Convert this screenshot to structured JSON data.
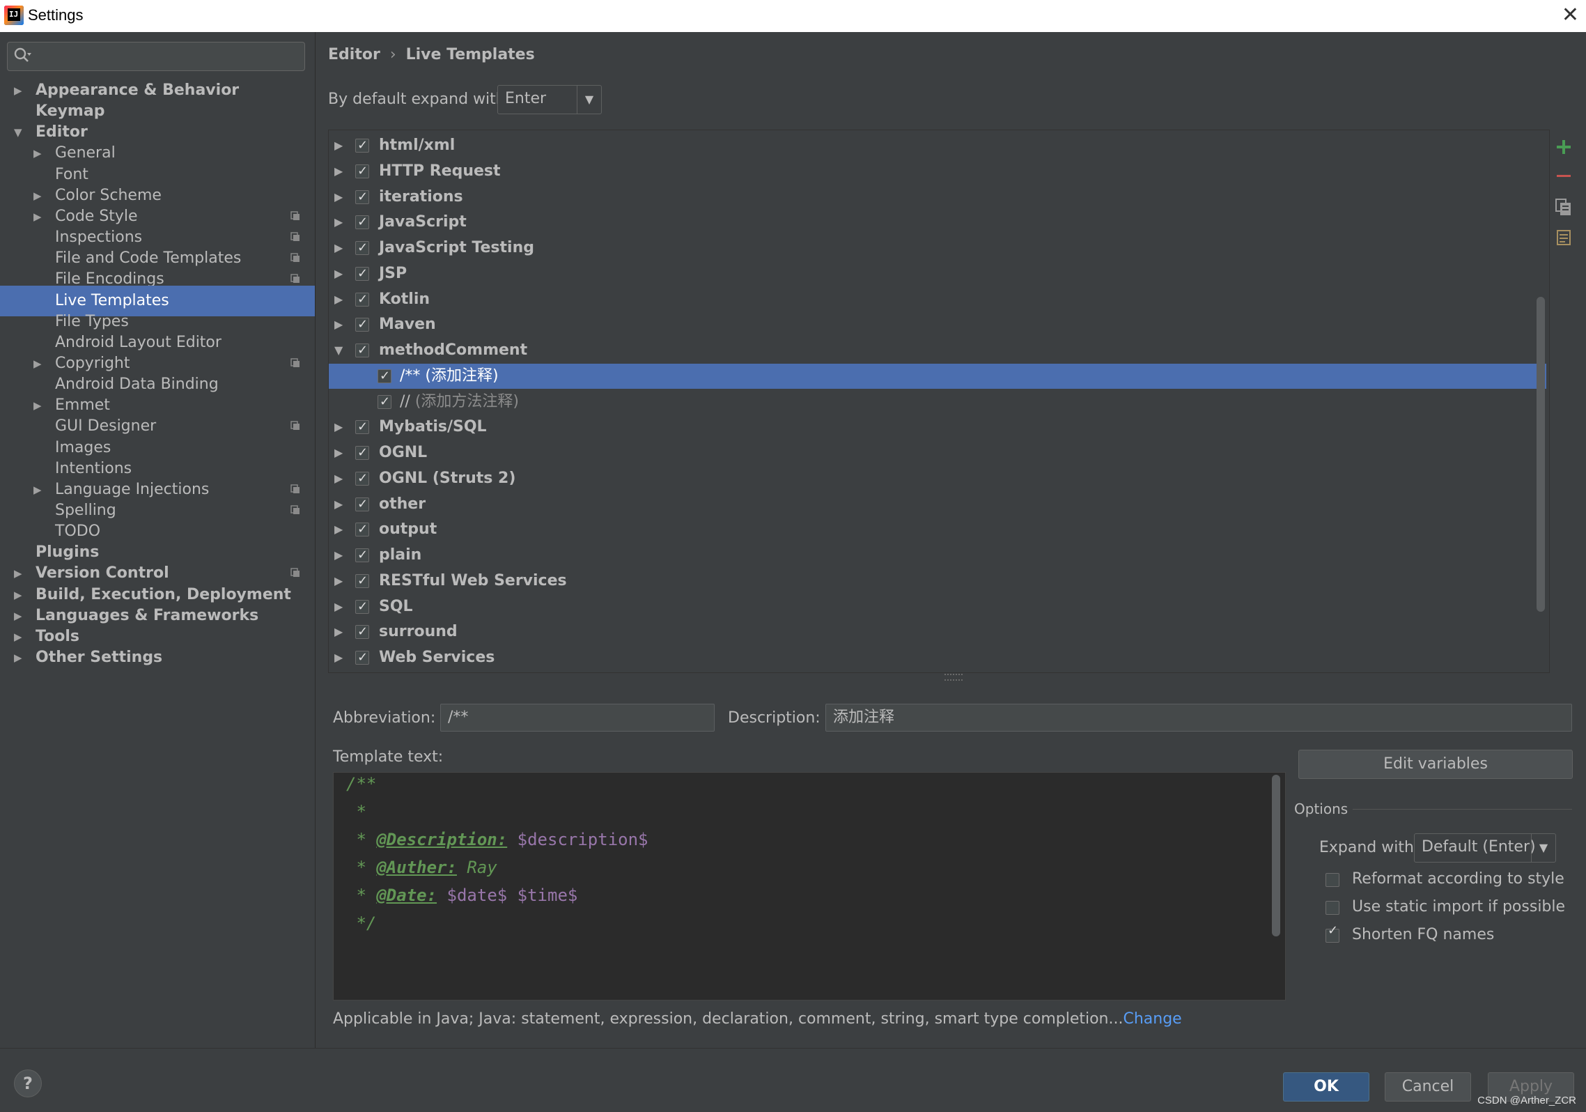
{
  "window": {
    "title": "Settings",
    "close_glyph": "✕",
    "logo_text": "IJ"
  },
  "search": {
    "placeholder": ""
  },
  "sidebar": {
    "items": [
      {
        "label": "Appearance & Behavior",
        "level": 0,
        "arrow": "▶",
        "bold": true
      },
      {
        "label": "Keymap",
        "level": 0,
        "arrow": "",
        "bold": true
      },
      {
        "label": "Editor",
        "level": 0,
        "arrow": "▼",
        "bold": true
      },
      {
        "label": "General",
        "level": 1,
        "arrow": "▶"
      },
      {
        "label": "Font",
        "level": 1,
        "arrow": ""
      },
      {
        "label": "Color Scheme",
        "level": 1,
        "arrow": "▶"
      },
      {
        "label": "Code Style",
        "level": 1,
        "arrow": "▶",
        "project_icon": true
      },
      {
        "label": "Inspections",
        "level": 1,
        "arrow": "",
        "project_icon": true
      },
      {
        "label": "File and Code Templates",
        "level": 1,
        "arrow": "",
        "project_icon": true
      },
      {
        "label": "File Encodings",
        "level": 1,
        "arrow": "",
        "project_icon": true
      },
      {
        "label": "Live Templates",
        "level": 1,
        "arrow": "",
        "selected": true
      },
      {
        "label": "File Types",
        "level": 1,
        "arrow": ""
      },
      {
        "label": "Android Layout Editor",
        "level": 1,
        "arrow": ""
      },
      {
        "label": "Copyright",
        "level": 1,
        "arrow": "▶",
        "project_icon": true
      },
      {
        "label": "Android Data Binding",
        "level": 1,
        "arrow": ""
      },
      {
        "label": "Emmet",
        "level": 1,
        "arrow": "▶"
      },
      {
        "label": "GUI Designer",
        "level": 1,
        "arrow": "",
        "project_icon": true
      },
      {
        "label": "Images",
        "level": 1,
        "arrow": ""
      },
      {
        "label": "Intentions",
        "level": 1,
        "arrow": ""
      },
      {
        "label": "Language Injections",
        "level": 1,
        "arrow": "▶",
        "project_icon": true
      },
      {
        "label": "Spelling",
        "level": 1,
        "arrow": "",
        "project_icon": true
      },
      {
        "label": "TODO",
        "level": 1,
        "arrow": ""
      },
      {
        "label": "Plugins",
        "level": 0,
        "arrow": "",
        "bold": true
      },
      {
        "label": "Version Control",
        "level": 0,
        "arrow": "▶",
        "bold": true,
        "project_icon": true
      },
      {
        "label": "Build, Execution, Deployment",
        "level": 0,
        "arrow": "▶",
        "bold": true
      },
      {
        "label": "Languages & Frameworks",
        "level": 0,
        "arrow": "▶",
        "bold": true
      },
      {
        "label": "Tools",
        "level": 0,
        "arrow": "▶",
        "bold": true
      },
      {
        "label": "Other Settings",
        "level": 0,
        "arrow": "▶",
        "bold": true
      }
    ]
  },
  "breadcrumb": {
    "parent": "Editor",
    "separator": "›",
    "current": "Live Templates"
  },
  "expand": {
    "label": "By default expand with",
    "value": "Enter",
    "dropdown_glyph": "▼"
  },
  "templates": {
    "rows": [
      {
        "type": "group",
        "label": "html/xml",
        "checked": true,
        "arrow": "▶"
      },
      {
        "type": "group",
        "label": "HTTP Request",
        "checked": true,
        "arrow": "▶"
      },
      {
        "type": "group",
        "label": "iterations",
        "checked": true,
        "arrow": "▶"
      },
      {
        "type": "group",
        "label": "JavaScript",
        "checked": true,
        "arrow": "▶"
      },
      {
        "type": "group",
        "label": "JavaScript Testing",
        "checked": true,
        "arrow": "▶"
      },
      {
        "type": "group",
        "label": "JSP",
        "checked": true,
        "arrow": "▶"
      },
      {
        "type": "group",
        "label": "Kotlin",
        "checked": true,
        "arrow": "▶"
      },
      {
        "type": "group",
        "label": "Maven",
        "checked": true,
        "arrow": "▶"
      },
      {
        "type": "group",
        "label": "methodComment",
        "checked": true,
        "arrow": "▼"
      },
      {
        "type": "child",
        "label": "/**",
        "desc": "(添加注释)",
        "checked": true,
        "selected": true
      },
      {
        "type": "child",
        "label": "//",
        "desc": "(添加方法注释)",
        "checked": true
      },
      {
        "type": "group",
        "label": "Mybatis/SQL",
        "checked": true,
        "arrow": "▶"
      },
      {
        "type": "group",
        "label": "OGNL",
        "checked": true,
        "arrow": "▶"
      },
      {
        "type": "group",
        "label": "OGNL (Struts 2)",
        "checked": true,
        "arrow": "▶"
      },
      {
        "type": "group",
        "label": "other",
        "checked": true,
        "arrow": "▶"
      },
      {
        "type": "group",
        "label": "output",
        "checked": true,
        "arrow": "▶"
      },
      {
        "type": "group",
        "label": "plain",
        "checked": true,
        "arrow": "▶"
      },
      {
        "type": "group",
        "label": "RESTful Web Services",
        "checked": true,
        "arrow": "▶"
      },
      {
        "type": "group",
        "label": "SQL",
        "checked": true,
        "arrow": "▶"
      },
      {
        "type": "group",
        "label": "surround",
        "checked": true,
        "arrow": "▶"
      },
      {
        "type": "group",
        "label": "Web Services",
        "checked": true,
        "arrow": "▶"
      }
    ]
  },
  "toolbar": {
    "add_icon": "plus-icon",
    "remove_icon": "minus-icon",
    "copy_icon": "copy-icon",
    "restore_icon": "restore-defaults-icon",
    "add_color": "#499c54",
    "remove_color": "#c75450"
  },
  "abbreviation": {
    "label": "Abbreviation:",
    "value": "/**"
  },
  "description": {
    "label": "Description:",
    "value": "添加注释"
  },
  "template_text": {
    "label": "Template text:",
    "lines": [
      [
        "/**"
      ],
      [
        " *"
      ],
      [
        " * ",
        "@Description:",
        " ",
        "$description$"
      ],
      [
        " * ",
        "@Auther:",
        " Ray"
      ],
      [
        " * ",
        "@Date:",
        " ",
        "$date$ $time$"
      ],
      [
        " */"
      ]
    ]
  },
  "edit_variables": {
    "label": "Edit variables"
  },
  "options": {
    "title": "Options",
    "expand_label": "Expand with",
    "expand_value": "Default (Enter)",
    "dropdown_glyph": "▼",
    "checkboxes": [
      {
        "label": "Reformat according to style",
        "checked": false
      },
      {
        "label": "Use static import if possible",
        "checked": false
      },
      {
        "label": "Shorten FQ names",
        "checked": true
      }
    ]
  },
  "applicable": {
    "text": "Applicable in Java; Java: statement, expression, declaration, comment, string, smart type completion...",
    "link": "Change"
  },
  "footer": {
    "help": "?",
    "ok": "OK",
    "cancel": "Cancel",
    "apply": "Apply",
    "watermark": "CSDN @Arther_ZCR"
  },
  "colors": {
    "background": "#3c3f41",
    "selection": "#4b6eaf",
    "editor_bg": "#2b2b2b",
    "link": "#589df6",
    "primary_button": "#365880"
  }
}
